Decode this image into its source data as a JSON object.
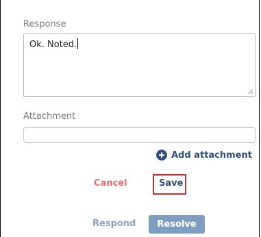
{
  "response": {
    "label": "Response",
    "value": "Ok. Noted."
  },
  "attachment": {
    "label": "Attachment",
    "value": "",
    "add_label": "Add attachment",
    "add_icon": "plus-circle-icon"
  },
  "actions": {
    "cancel_label": "Cancel",
    "save_label": "Save",
    "respond_label": "Respond",
    "resolve_label": "Resolve"
  },
  "colors": {
    "cancel": "#e86b6b",
    "primary_text": "#2f4f7a",
    "highlight": "#e02424",
    "resolve_bg": "#7f9dc1",
    "respond_text": "#8aa2be"
  }
}
